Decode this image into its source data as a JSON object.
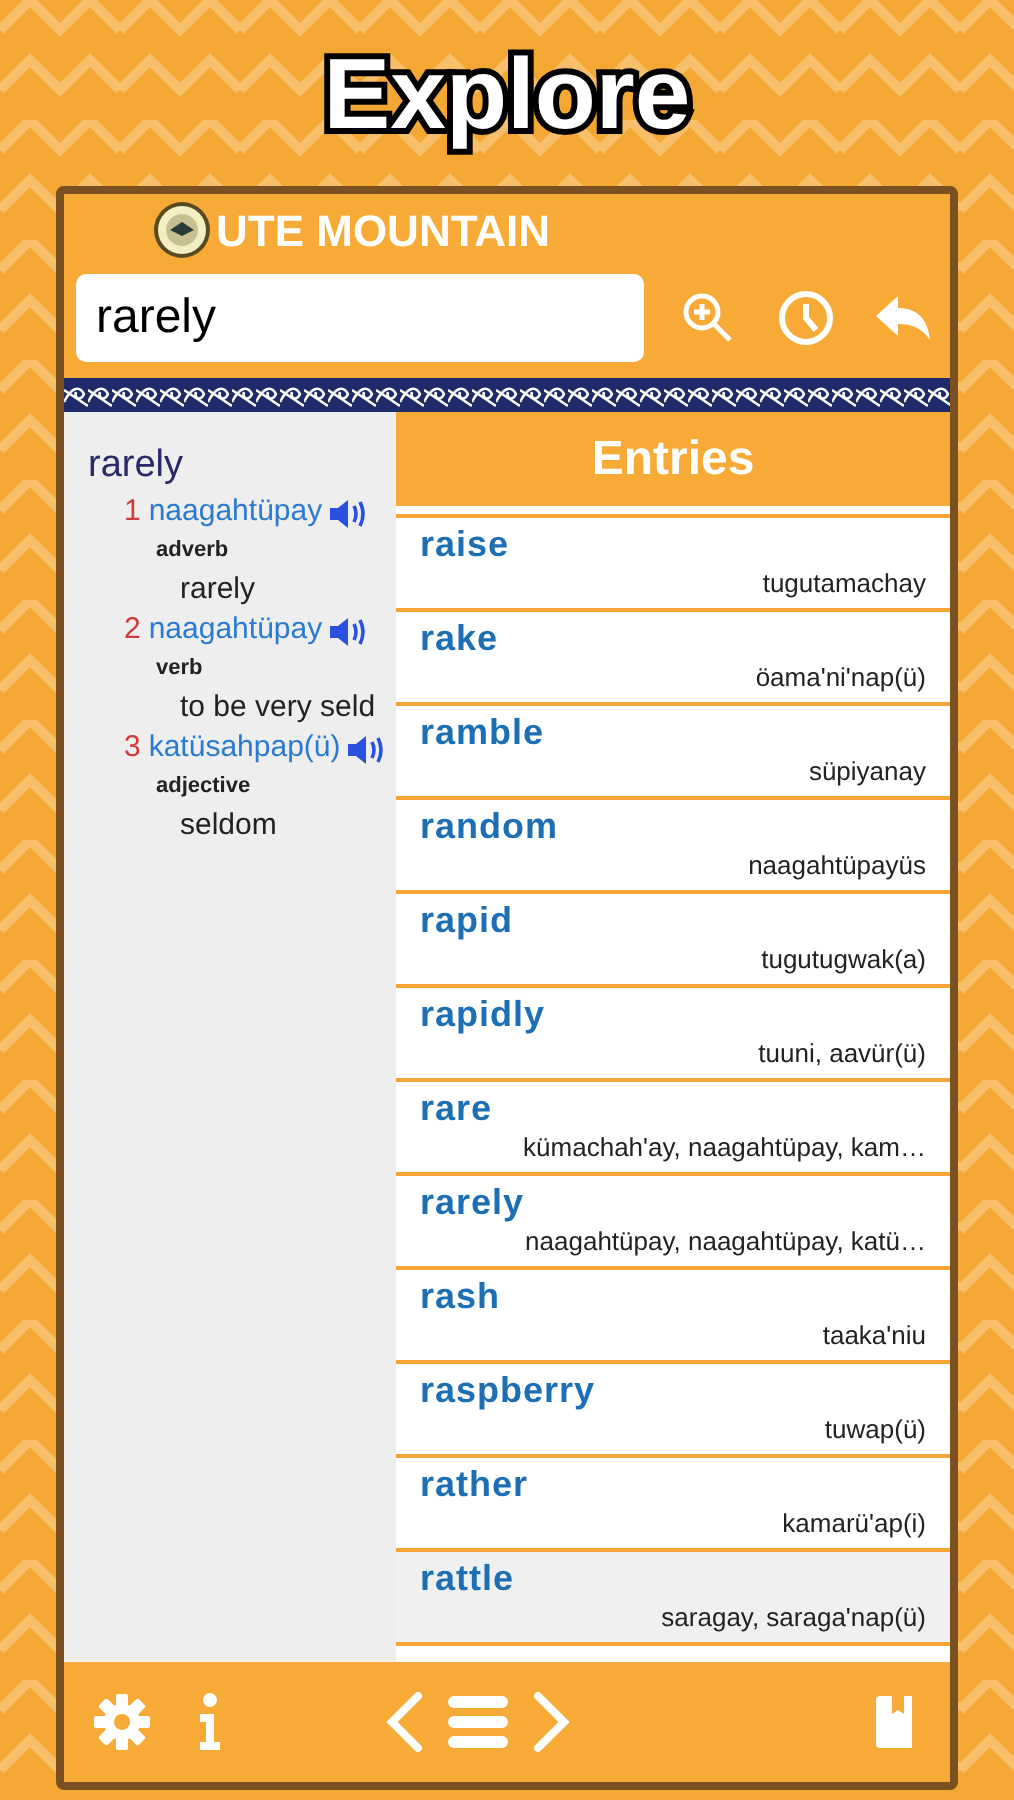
{
  "title": "Explore",
  "header": {
    "logo_text": "UTE MOUNTAIN",
    "search": {
      "value": "rarely"
    }
  },
  "detail": {
    "headword": "rarely",
    "senses": [
      {
        "number": "1",
        "word": "naagahtüpay",
        "pos": "adverb",
        "definition": "rarely"
      },
      {
        "number": "2",
        "word": "naagahtüpay",
        "pos": "verb",
        "definition": "to be very seld"
      },
      {
        "number": "3",
        "word": "katüsahpap(ü)",
        "pos": "adjective",
        "definition": "seldom"
      }
    ]
  },
  "entries": {
    "title": "Entries",
    "items": [
      {
        "word": "raise",
        "translation": "tugutamachay",
        "highlighted": false
      },
      {
        "word": "rake",
        "translation": "öama'ni'nap(ü)",
        "highlighted": false
      },
      {
        "word": "ramble",
        "translation": "süpiyanay",
        "highlighted": false
      },
      {
        "word": "random",
        "translation": "naagahtüpayüs",
        "highlighted": false
      },
      {
        "word": "rapid",
        "translation": "tugutugwak(a)",
        "highlighted": false
      },
      {
        "word": "rapidly",
        "translation": "tuuni, aavür(ü)",
        "highlighted": false
      },
      {
        "word": "rare",
        "translation": "kümachah'ay, naagahtüpay, kam…",
        "highlighted": false
      },
      {
        "word": "rarely",
        "translation": "naagahtüpay, naagahtüpay, katü…",
        "highlighted": false
      },
      {
        "word": "rash",
        "translation": "taaka'niu",
        "highlighted": false
      },
      {
        "word": "raspberry",
        "translation": "tuwap(ü)",
        "highlighted": false
      },
      {
        "word": "rather",
        "translation": "kamarü'ap(i)",
        "highlighted": false
      },
      {
        "word": "rattle",
        "translation": "saragay, saraga'nap(ü)",
        "highlighted": true
      }
    ]
  }
}
